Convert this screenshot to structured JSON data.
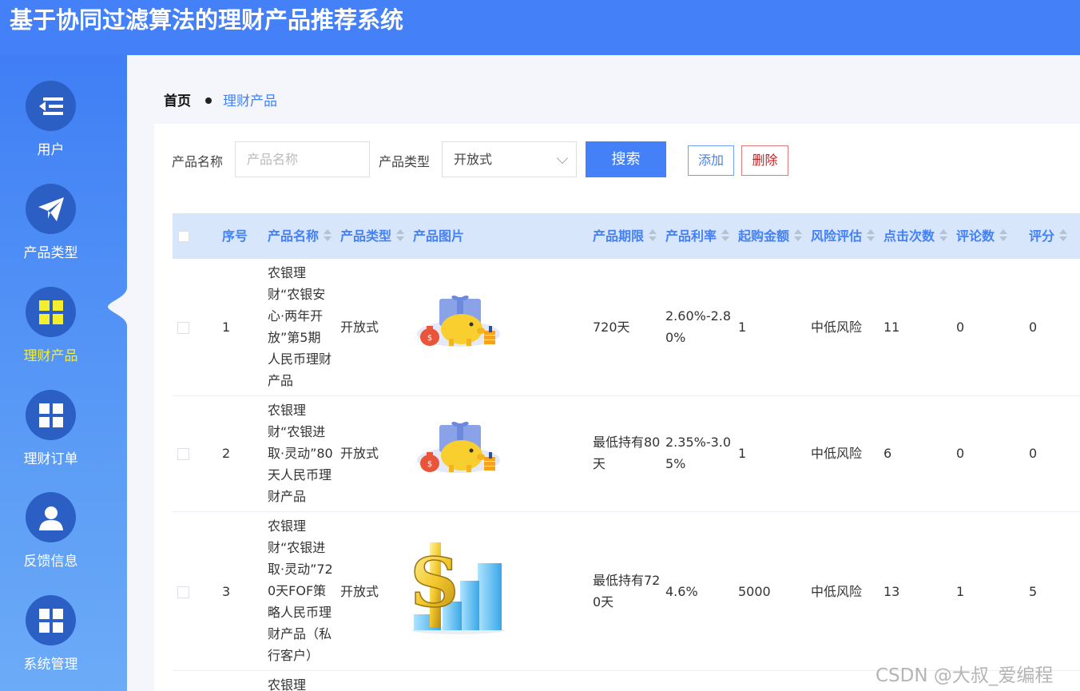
{
  "app": {
    "title": "基于协同过滤算法的理财产品推荐系统"
  },
  "sidebar": {
    "items": [
      {
        "label": "用户",
        "icon": "menu-list-icon"
      },
      {
        "label": "产品类型",
        "icon": "paper-plane-icon"
      },
      {
        "label": "理财产品",
        "icon": "grid-icon",
        "active": true
      },
      {
        "label": "理财订单",
        "icon": "grid-icon"
      },
      {
        "label": "反馈信息",
        "icon": "user-icon"
      },
      {
        "label": "系统管理",
        "icon": "grid-icon"
      }
    ]
  },
  "breadcrumb": {
    "home": "首页",
    "current": "理财产品"
  },
  "search": {
    "name_label": "产品名称",
    "name_placeholder": "产品名称",
    "type_label": "产品类型",
    "type_value": "开放式",
    "search_button": "搜索",
    "add_button": "添加",
    "delete_button": "删除"
  },
  "table": {
    "columns": [
      "序号",
      "产品名称",
      "产品类型",
      "产品图片",
      "产品期限",
      "产品利率",
      "起购金额",
      "风险评估",
      "点击次数",
      "评论数",
      "评分"
    ],
    "rows": [
      {
        "index": "1",
        "name_lines": [
          "农银理",
          "财“农银安",
          "心·两年开",
          "放”第5期",
          "人民币理财",
          "产品"
        ],
        "type": "开放式",
        "image": "piggy-bank-image",
        "term_lines": [
          "720天"
        ],
        "rate_lines": [
          "2.60%-2.8",
          "0%"
        ],
        "min_amount": "1",
        "risk": "中低风险",
        "clicks": "11",
        "comments": "0",
        "score": "0"
      },
      {
        "index": "2",
        "name_lines": [
          "农银理",
          "财“农银进",
          "取·灵动”80",
          "天人民币理",
          "财产品"
        ],
        "type": "开放式",
        "image": "piggy-bank-image",
        "term_lines": [
          "最低持有80",
          "天"
        ],
        "rate_lines": [
          "2.35%-3.0",
          "5%"
        ],
        "min_amount": "1",
        "risk": "中低风险",
        "clicks": "6",
        "comments": "0",
        "score": "0"
      },
      {
        "index": "3",
        "name_lines": [
          "农银理",
          "财“农银进",
          "取·灵动”72",
          "0天FOF策",
          "略人民币理",
          "财产品（私",
          "行客户）"
        ],
        "type": "开放式",
        "image": "dollar-chart-image",
        "term_lines": [
          "最低持有72",
          "0天"
        ],
        "rate_lines": [
          "4.6%"
        ],
        "min_amount": "5000",
        "risk": "中低风险",
        "clicks": "13",
        "comments": "1",
        "score": "5"
      },
      {
        "index": "",
        "name_lines": [
          "农银理"
        ],
        "type": "",
        "image": "",
        "term_lines": [],
        "rate_lines": [],
        "min_amount": "",
        "risk": "",
        "clicks": "",
        "comments": "",
        "score": ""
      }
    ]
  },
  "watermark": "CSDN @大叔_爱编程",
  "colors": {
    "primary": "#4480f7",
    "active_nav": "#f5ee2e",
    "danger": "#c81e1e"
  }
}
